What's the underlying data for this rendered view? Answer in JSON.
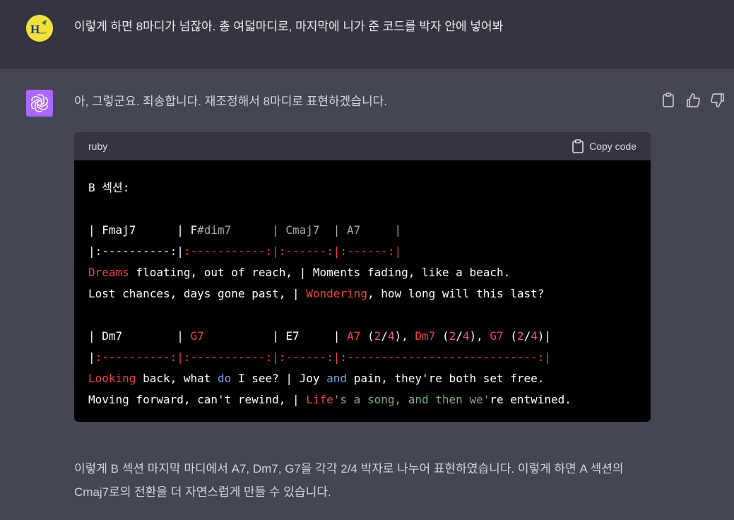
{
  "user_message": {
    "text": "이렇게 하면 8마디가 넘잖아. 총 여덟마디로, 마지막에 니가 준 코드를 박자 안에 넣어봐",
    "avatar_letters": "H",
    "avatar_small_text": "DIARY"
  },
  "assistant_message": {
    "intro": "아, 그렇군요. 죄송합니다. 재조정해서 8마디로 표현하겠습니다.",
    "code_block": {
      "language": "ruby",
      "copy_label": "Copy code",
      "lines": [
        [
          {
            "t": "B 섹션:",
            "c": "default"
          }
        ],
        [],
        [
          {
            "t": "| Fmaj7      | F",
            "c": "default"
          },
          {
            "t": "#dim7      | Cmaj7  | A7     |",
            "c": "gray"
          }
        ],
        [
          {
            "t": "|:----------:|",
            "c": "default"
          },
          {
            "t": ":-----------:|:------:|:------:|",
            "c": "red"
          }
        ],
        [
          {
            "t": "Dreams",
            "c": "red"
          },
          {
            "t": " floating, out of reach, | Moments fading, like a beach.",
            "c": "default"
          }
        ],
        [
          {
            "t": "Lost chances, days gone past, | ",
            "c": "default"
          },
          {
            "t": "Wondering",
            "c": "red"
          },
          {
            "t": ", how long will this last?",
            "c": "default"
          }
        ],
        [],
        [
          {
            "t": "| Dm7        | ",
            "c": "default"
          },
          {
            "t": "G7",
            "c": "red"
          },
          {
            "t": "          | E7     | ",
            "c": "default"
          },
          {
            "t": "A7",
            "c": "red"
          },
          {
            "t": " (",
            "c": "default"
          },
          {
            "t": "2",
            "c": "pink"
          },
          {
            "t": "/",
            "c": "default"
          },
          {
            "t": "4",
            "c": "pink"
          },
          {
            "t": "), ",
            "c": "default"
          },
          {
            "t": "Dm7",
            "c": "red"
          },
          {
            "t": " (",
            "c": "default"
          },
          {
            "t": "2",
            "c": "pink"
          },
          {
            "t": "/",
            "c": "default"
          },
          {
            "t": "4",
            "c": "pink"
          },
          {
            "t": "), ",
            "c": "default"
          },
          {
            "t": "G7",
            "c": "red"
          },
          {
            "t": " (",
            "c": "default"
          },
          {
            "t": "2",
            "c": "pink"
          },
          {
            "t": "/",
            "c": "default"
          },
          {
            "t": "4",
            "c": "pink"
          },
          {
            "t": ")|",
            "c": "default"
          }
        ],
        [
          {
            "t": "|",
            "c": "default"
          },
          {
            "t": ":----------:|:-----------:|:------:|:----------------------------:|",
            "c": "red"
          }
        ],
        [
          {
            "t": "Looking",
            "c": "red"
          },
          {
            "t": " back, what ",
            "c": "default"
          },
          {
            "t": "do",
            "c": "blue"
          },
          {
            "t": " I see? | Joy ",
            "c": "default"
          },
          {
            "t": "and",
            "c": "blue"
          },
          {
            "t": " pain, they're both set free.",
            "c": "default"
          }
        ],
        [
          {
            "t": "Moving forward, can't rewind, | ",
            "c": "default"
          },
          {
            "t": "Life",
            "c": "red"
          },
          {
            "t": "'s a song, and then we'",
            "c": "green"
          },
          {
            "t": "re entwined.",
            "c": "default"
          }
        ]
      ]
    },
    "outro": "이렇게 B 섹션 마지막 마디에서 A7, Dm7, G7을 각각 2/4 박자로 나누어 표현하였습니다. 이렇게 하면 A 섹션의 Cmaj7로의 전환을 더 자연스럽게 만들 수 있습니다."
  },
  "colors": {
    "user_bg": "#343541",
    "assistant_bg": "#444654",
    "code_bg": "#000000",
    "code_header_bg": "#343541",
    "bot_avatar": "#ab68ff",
    "user_avatar": "#f2e13c"
  },
  "icons": [
    "copy-icon",
    "thumbs-up-icon",
    "thumbs-down-icon",
    "clipboard-icon",
    "openai-logo-icon"
  ]
}
